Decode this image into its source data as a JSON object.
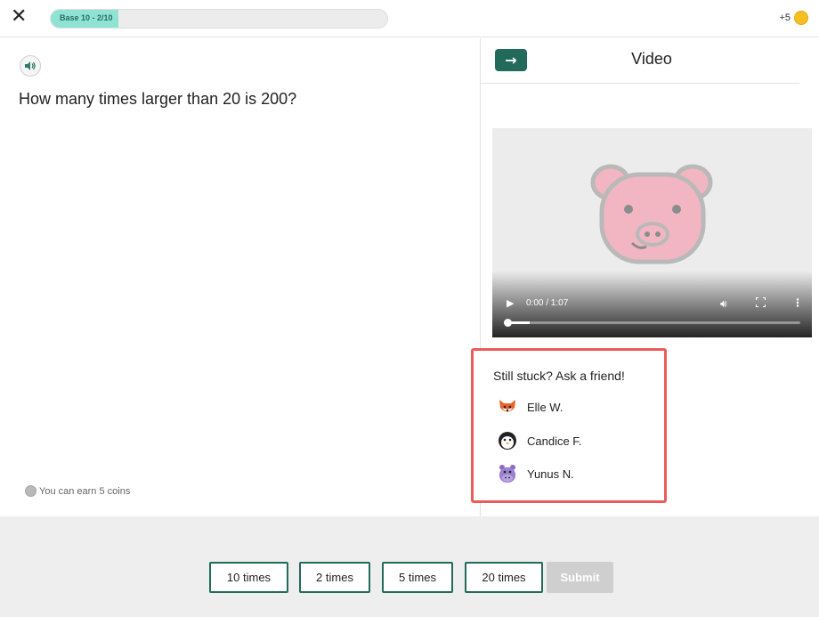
{
  "topbar": {
    "close_icon": "close-icon",
    "progress_label": "Base 10 - 2/10",
    "progress_fraction": 0.2,
    "coins_label": "+5"
  },
  "question": {
    "speaker_icon": "speaker-icon",
    "text": "How many times larger than 20 is 200?",
    "earn_text": "You can earn 5 coins"
  },
  "video_panel": {
    "arrow_icon": "arrow-right-icon",
    "title": "Video",
    "time": "0:00 / 1:07",
    "progress_fraction": 0.08
  },
  "friends": {
    "title": "Still stuck? Ask a friend!",
    "items": [
      {
        "name": "Elle W.",
        "avatar": "fox-avatar"
      },
      {
        "name": "Candice F.",
        "avatar": "penguin-avatar"
      },
      {
        "name": "Yunus N.",
        "avatar": "hippo-avatar"
      }
    ]
  },
  "answers": {
    "options": [
      "10 times",
      "2 times",
      "5 times",
      "20 times"
    ],
    "submit_label": "Submit"
  },
  "colors": {
    "accent": "#226b5b",
    "progress_fill": "#8fe3d5",
    "highlight_border": "#ea5b5b",
    "coin": "#f6c022"
  }
}
